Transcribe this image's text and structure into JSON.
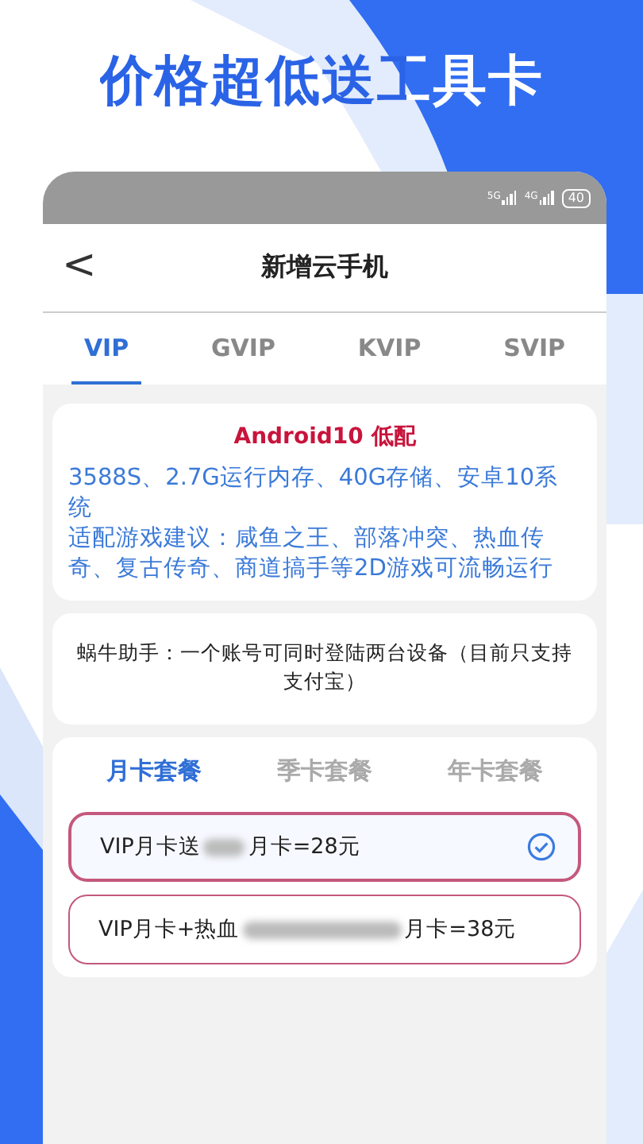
{
  "headline": "价格超低送工具卡",
  "status_bar": {
    "network_1": "5G",
    "network_2": "4G",
    "battery": "40"
  },
  "header": {
    "back": "<",
    "title": "新增云手机"
  },
  "tabs": [
    {
      "label": "VIP",
      "selected": true
    },
    {
      "label": "GVIP",
      "selected": false
    },
    {
      "label": "KVIP",
      "selected": false
    },
    {
      "label": "SVIP",
      "selected": false
    }
  ],
  "spec_card": {
    "title": "Android10 低配",
    "lines": [
      "3588S、2.7G运行内存、40G存储、安卓10系统",
      "适配游戏建议：咸鱼之王、部落冲突、热血传奇、复古传奇、商道搞手等2D游戏可流畅运行"
    ]
  },
  "notice": "蜗牛助手：一个账号可同时登陆两台设备（目前只支持支付宝）",
  "package_tabs": [
    {
      "label": "月卡套餐",
      "selected": true
    },
    {
      "label": "季卡套餐",
      "selected": false
    },
    {
      "label": "年卡套餐",
      "selected": false
    }
  ],
  "options": [
    {
      "label_start": "VIP月卡送",
      "label_end": "月卡=28元",
      "kind": "short",
      "selected": true
    },
    {
      "label_start": "VIP月卡+热血",
      "label_end": "月卡=38元",
      "kind": "long",
      "selected": false
    }
  ]
}
